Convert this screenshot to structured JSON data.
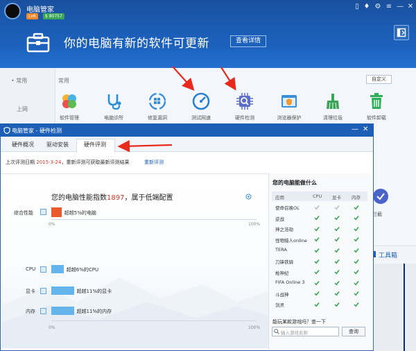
{
  "main": {
    "app_title": "电脑管家",
    "level_badge": "Lv6",
    "vip_badge": "$ 80757",
    "headline": "你的电脑有新的软件可更新",
    "detail_button": "查看详情",
    "nav_common": "• 常用",
    "nav_online": "上网",
    "section_title": "常用",
    "custom_button": "自定义",
    "tools": [
      {
        "label": "软件管理",
        "icon": "software-manager-icon"
      },
      {
        "label": "电脑诊所",
        "icon": "pc-clinic-icon"
      },
      {
        "label": "修复漏洞",
        "icon": "fix-vulnerability-icon"
      },
      {
        "label": "测试网速",
        "icon": "speed-test-icon"
      },
      {
        "label": "硬件检测",
        "icon": "hardware-detect-icon"
      },
      {
        "label": "浏览器保护",
        "icon": "browser-protect-icon"
      },
      {
        "label": "清理垃圾",
        "icon": "clean-junk-icon"
      },
      {
        "label": "软件卸载",
        "icon": "uninstall-icon"
      }
    ],
    "peek_label": "拦截",
    "peek_toolbox": "工具箱"
  },
  "dialog": {
    "title": "电脑管家 - 硬件检测",
    "tabs": [
      "硬件概况",
      "驱动安装",
      "硬件评测"
    ],
    "active_tab": "硬件评测",
    "info_prefix": "上次评测日期 ",
    "info_date": "2015-3-24",
    "info_suffix": "，重新评测可获取最新评测结果",
    "re_eval_link": "重新评测",
    "score_prefix": "您的电脑性能指数",
    "score_value": "1897",
    "score_suffix": "，属于低端配置",
    "overall": {
      "label": "综合性能",
      "value": 5,
      "text": "超越5%的电脑"
    },
    "components": [
      {
        "label": "CPU",
        "value": 6,
        "text": "超越6%的CPU"
      },
      {
        "label": "显卡",
        "value": 11,
        "text": "超越11%的显卡"
      },
      {
        "label": "内存",
        "value": 11,
        "text": "超越11%的内存"
      }
    ],
    "axis_min": "0%",
    "axis_max": "100%",
    "games_title": "您的电脑能做什么",
    "games_headers": [
      "应用",
      "CPU",
      "显卡",
      "内存"
    ],
    "games": [
      {
        "name": "使命召唤OL",
        "checks": [
          false,
          false,
          true
        ]
      },
      {
        "name": "逆战",
        "checks": [
          true,
          true,
          true
        ]
      },
      {
        "name": "神之浩劫",
        "checks": [
          true,
          true,
          true
        ]
      },
      {
        "name": "怪物猎人online",
        "checks": [
          true,
          true,
          true
        ]
      },
      {
        "name": "TERA",
        "checks": [
          true,
          true,
          true
        ]
      },
      {
        "name": "刀锋铁骑",
        "checks": [
          true,
          true,
          true
        ]
      },
      {
        "name": "枪神纪",
        "checks": [
          true,
          true,
          true
        ]
      },
      {
        "name": "FIFA Online 3",
        "checks": [
          true,
          true,
          true
        ]
      },
      {
        "name": "斗战神",
        "checks": [
          true,
          true,
          true
        ]
      },
      {
        "name": "剑灵",
        "checks": [
          true,
          true,
          true
        ]
      }
    ],
    "query_text": "能玩某款游戏吗？查一下",
    "search_placeholder": "输入游戏名称",
    "query_button": "查询"
  },
  "colors": {
    "header_blue": "#1b5cb4",
    "score_red": "#d23a2a",
    "bar_orange": "#ea5a2c",
    "bar_blue": "#63b5ec",
    "check_green": "#3aa655",
    "arrow_red": "#e8291c"
  }
}
